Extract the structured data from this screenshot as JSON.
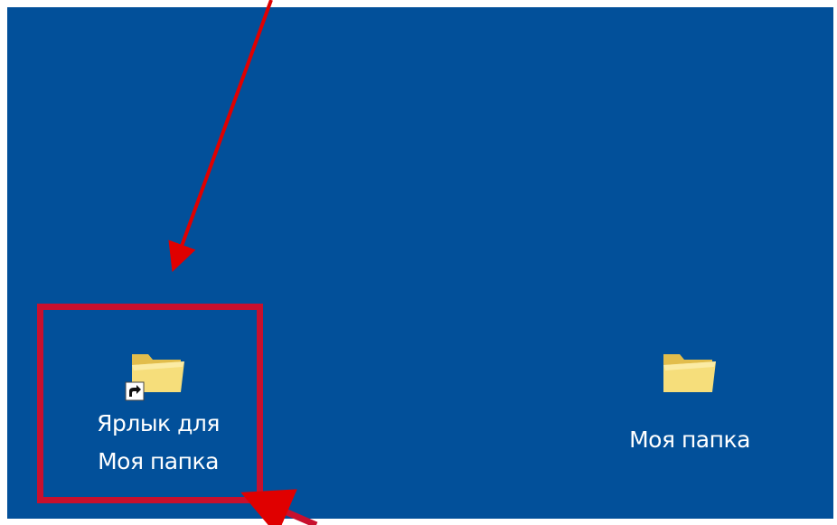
{
  "desktop": {
    "background_color": "#02509a",
    "icons": [
      {
        "label_line1": "Ярлык для",
        "label_line2": "Моя папка",
        "icon": "folder-icon",
        "overlay": "shortcut-arrow-icon",
        "highlighted": true
      },
      {
        "label": "Моя папка",
        "icon": "folder-icon"
      }
    ]
  },
  "annotations": {
    "highlight_color": "#c8102e",
    "arrow_color": "#e00000"
  }
}
